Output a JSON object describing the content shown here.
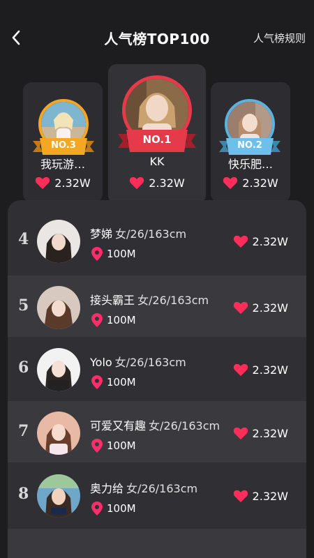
{
  "header": {
    "title": "人气榜TOP100",
    "rules_label": "人气榜规则"
  },
  "podium": [
    {
      "rank_label": "NO.1",
      "name": "KK",
      "likes": "2.32W",
      "ring_color": "#e53a4a"
    },
    {
      "rank_label": "NO.2",
      "name": "快乐肥…",
      "likes": "2.32W",
      "ring_color": "#5ab2e0"
    },
    {
      "rank_label": "NO.3",
      "name": "我玩游…",
      "likes": "2.32W",
      "ring_color": "#f5a623"
    }
  ],
  "list": [
    {
      "rank": "4",
      "name": "梦娣",
      "info": "女/26/163cm",
      "distance": "100M",
      "likes": "2.32W"
    },
    {
      "rank": "5",
      "name": "接头霸王",
      "info": "女/26/163cm",
      "distance": "100M",
      "likes": "2.32W"
    },
    {
      "rank": "6",
      "name": "Yolo",
      "info": "女/26/163cm",
      "distance": "100M",
      "likes": "2.32W"
    },
    {
      "rank": "7",
      "name": "可爱又有趣",
      "info": "女/26/163cm",
      "distance": "100M",
      "likes": "2.32W"
    },
    {
      "rank": "8",
      "name": "奥力给",
      "info": "女/26/163cm",
      "distance": "100M",
      "likes": "2.32W"
    }
  ],
  "colors": {
    "heart": "#ff2d5a",
    "location": "#ff2d6a",
    "background": "#1d1c1f",
    "panel": "#302f33"
  },
  "icons": {
    "back": "chevron-left-icon",
    "heart": "heart-icon",
    "location": "location-pin-icon"
  }
}
